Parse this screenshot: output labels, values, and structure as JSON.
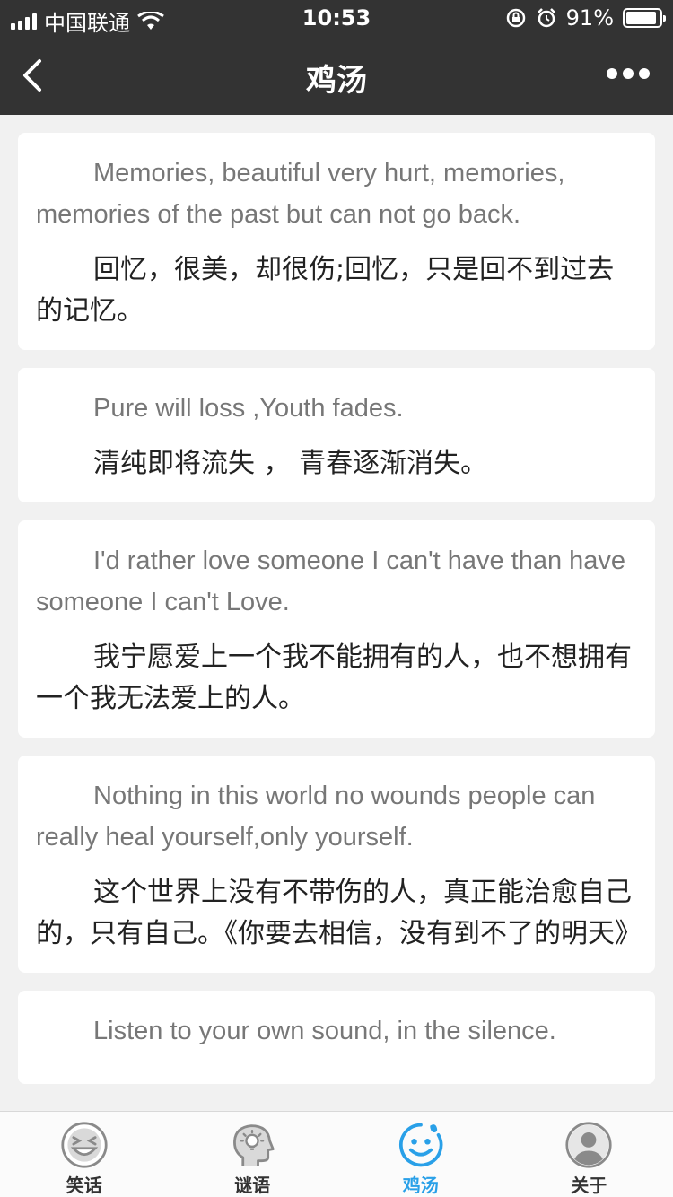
{
  "status_bar": {
    "carrier": "中国联通",
    "time": "10:53",
    "battery": "91%",
    "battery_level": 0.91
  },
  "nav": {
    "title": "鸡汤"
  },
  "cards": [
    {
      "en": "Memories, beautiful very hurt, memories, memories of the past but can not go back.",
      "zh": "回忆，很美，却很伤;回忆，只是回不到过去的记忆。"
    },
    {
      "en": "Pure will loss ,Youth fades.",
      "zh": "清纯即将流失 ， 青春逐渐消失。"
    },
    {
      "en": "I'd rather love someone I can't have than have someone I can't Love.",
      "zh": "我宁愿爱上一个我不能拥有的人，也不想拥有一个我无法爱上的人。"
    },
    {
      "en": "Nothing in this world no wounds people can really heal yourself,only yourself.",
      "zh": "这个世界上没有不带伤的人，真正能治愈自己的，只有自己。《你要去相信，没有到不了的明天》"
    },
    {
      "en": "Listen to your own sound, in the silence.",
      "zh": ""
    }
  ],
  "tabs": [
    {
      "label": "笑话",
      "icon": "laughing-face-icon",
      "active": false
    },
    {
      "label": "谜语",
      "icon": "thinking-head-icon",
      "active": false
    },
    {
      "label": "鸡汤",
      "icon": "smile-face-icon",
      "active": true
    },
    {
      "label": "关于",
      "icon": "user-avatar-icon",
      "active": false
    }
  ],
  "colors": {
    "bar": "#333333",
    "accent": "#29a0e8",
    "background": "#f1f1f1"
  }
}
